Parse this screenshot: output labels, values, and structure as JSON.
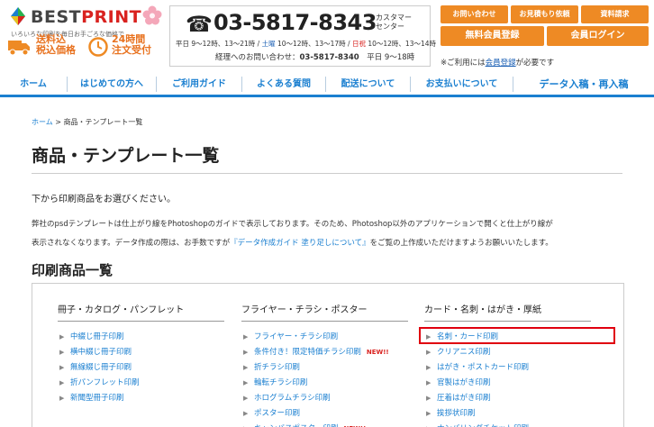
{
  "header": {
    "logo_best": "BEST",
    "logo_print": "PRINT",
    "logo_tagline": "いろいろな印刷を毎日お手ごろな価格で",
    "badge1_line1": "送料込",
    "badge1_line2": "税込価格",
    "badge2_line1": "24時間",
    "badge2_line2": "注文受付",
    "phone": "03-5817-8343",
    "phone_label_1": "カスタマー",
    "phone_label_2": "センター",
    "hours_weekday": "平日 9〜12時、13〜21時 / ",
    "hours_sat_label": "土曜",
    "hours_sat": " 10〜12時、13〜17時 / ",
    "hours_sun_label": "日祝",
    "hours_sun": " 10〜12時、13〜14時",
    "accounting_label": "経理へのお問い合わせ：",
    "accounting_phone": "03-5817-8340",
    "accounting_hours": "平日 9〜18時",
    "btn_contact": "お問い合わせ",
    "btn_quote": "お見積もり依頼",
    "btn_docs": "資料請求",
    "btn_register": "無料会員登録",
    "btn_login": "会員ログイン",
    "note_pre": "※ご利用には",
    "note_link": "会員登録",
    "note_post": "が必要です"
  },
  "nav": {
    "items": [
      "ホーム",
      "はじめての方へ",
      "ご利用ガイド",
      "よくある質問",
      "配送について",
      "お支払いについて",
      "データ入稿・再入稿"
    ]
  },
  "breadcrumb": {
    "home": "ホーム",
    "sep": " > ",
    "current": "商品・テンプレート一覧"
  },
  "page": {
    "title": "商品・テンプレート一覧",
    "intro": "下から印刷商品をお選びください。",
    "para_1": "弊社のpsdテンプレートは仕上がり線をPhotoshopのガイドで表示しております。そのため、Photoshop以外のアプリケーションで開くと仕上がり線が",
    "para_2": "表示されなくなります。データ作成の際は、お手数ですが",
    "para_link": "『データ作成ガイド 塗り足しについて』",
    "para_3": "をご覧の上作成いただけますようお願いいたします。",
    "section_title": "印刷商品一覧"
  },
  "columns": [
    {
      "heading": "冊子・カタログ・パンフレット",
      "items": [
        {
          "label": "中綴じ冊子印刷",
          "new": ""
        },
        {
          "label": "横中綴じ冊子印刷",
          "new": ""
        },
        {
          "label": "無線綴じ冊子印刷",
          "new": ""
        },
        {
          "label": "折パンフレット印刷",
          "new": ""
        },
        {
          "label": "新聞型冊子印刷",
          "new": ""
        }
      ]
    },
    {
      "heading": "フライヤー・チラシ・ポスター",
      "items": [
        {
          "label": "フライヤー・チラシ印刷",
          "new": ""
        },
        {
          "label": "条件付き！限定特価チラシ印刷",
          "new": "NEW!!"
        },
        {
          "label": "折チラシ印刷",
          "new": ""
        },
        {
          "label": "輪転チラシ印刷",
          "new": ""
        },
        {
          "label": "ホログラムチラシ印刷",
          "new": ""
        },
        {
          "label": "ポスター印刷",
          "new": ""
        },
        {
          "label": "キャンバスポスター印刷",
          "new": "NEW!!"
        }
      ]
    },
    {
      "heading": "カード・名刺・はがき・厚紙",
      "items": [
        {
          "label": "名刺・カード印刷",
          "new": ""
        },
        {
          "label": "クリアニス印刷",
          "new": ""
        },
        {
          "label": "はがき・ポストカード印刷",
          "new": ""
        },
        {
          "label": "官製はがき印刷",
          "new": ""
        },
        {
          "label": "圧着はがき印刷",
          "new": ""
        },
        {
          "label": "挨拶状印刷",
          "new": ""
        },
        {
          "label": "ナンバリングチケット印刷",
          "new": ""
        }
      ]
    }
  ],
  "icons": {
    "arrow": "▶",
    "phone": "☎"
  },
  "colors": {
    "accent_blue": "#1a7fd0",
    "orange": "#ee8a24",
    "red": "#d9221f",
    "highlight": "#e0000f"
  }
}
